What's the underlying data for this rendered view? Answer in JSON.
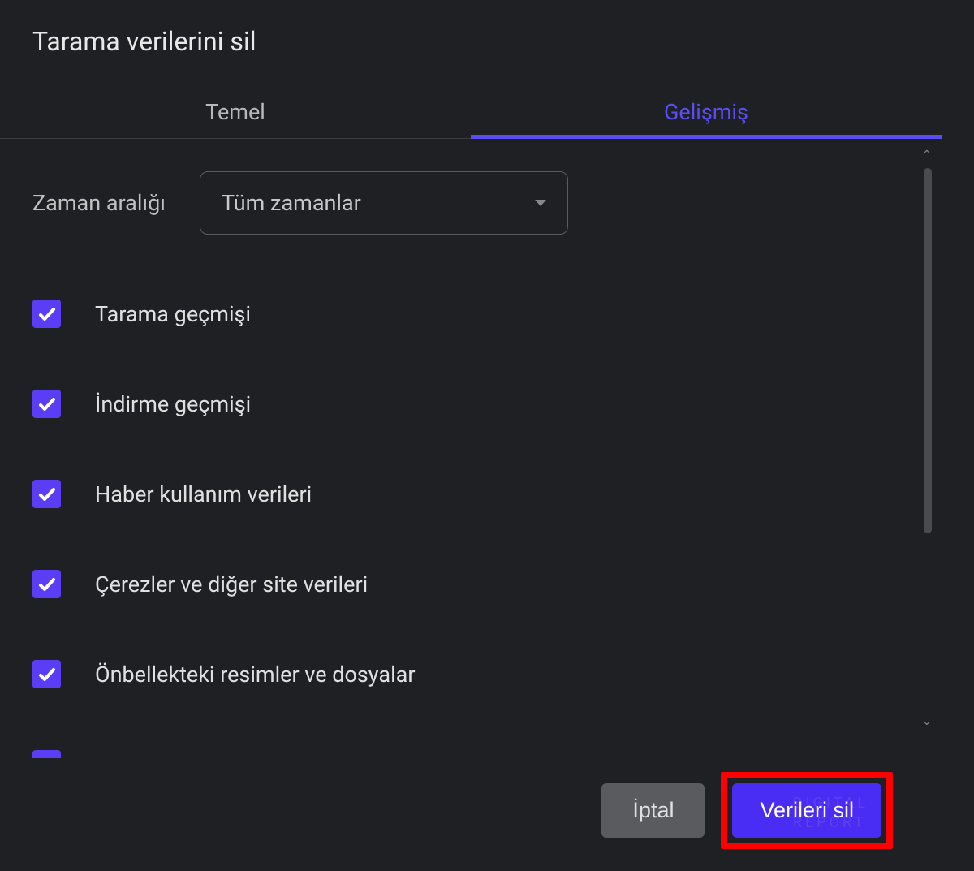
{
  "dialog": {
    "title": "Tarama verilerini sil"
  },
  "tabs": {
    "basic": "Temel",
    "advanced": "Gelişmiş"
  },
  "timeRange": {
    "label": "Zaman aralığı",
    "selected": "Tüm zamanlar"
  },
  "options": [
    {
      "label": "Tarama geçmişi",
      "checked": true
    },
    {
      "label": "İndirme geçmişi",
      "checked": true
    },
    {
      "label": "Haber kullanım verileri",
      "checked": true
    },
    {
      "label": "Çerezler ve diğer site verileri",
      "checked": true
    },
    {
      "label": "Önbellekteki resimler ve dosyalar",
      "checked": true
    }
  ],
  "footer": {
    "cancel": "İptal",
    "clear": "Verileri sil"
  },
  "watermark": {
    "line1": "DIGITAL",
    "line2": "REPORT"
  }
}
